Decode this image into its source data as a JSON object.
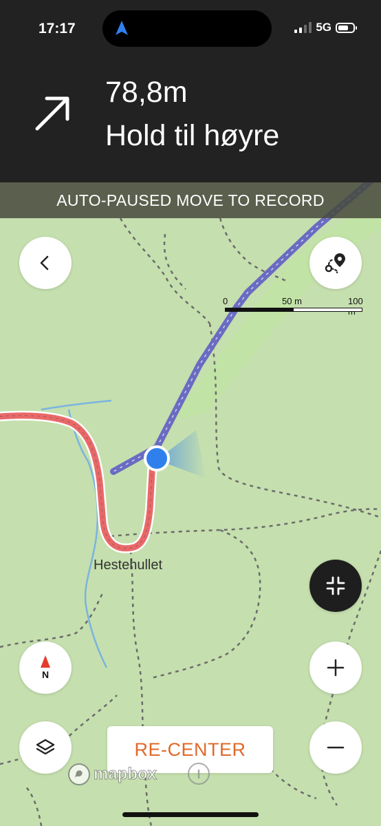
{
  "status_bar": {
    "time": "17:17",
    "network": "5G",
    "signal_bars": 2,
    "signal_bars_total": 4,
    "location_icon": "navigation-arrow-icon"
  },
  "navigation": {
    "distance": "78,8m",
    "instruction": "Hold til høyre",
    "turn_icon": "arrow-up-right-icon"
  },
  "banner": {
    "text": "AUTO-PAUSED MOVE TO RECORD"
  },
  "scale": {
    "labels": [
      "0",
      "50 m",
      "100 m"
    ]
  },
  "map": {
    "place_label": "Hestehullet",
    "attribution": "mapbox"
  },
  "buttons": {
    "back": "chevron-left-icon",
    "route": "route-pin-icon",
    "collapse": "collapse-arrows-icon",
    "compass": "compass-icon",
    "compass_label": "N",
    "zoom_in": "plus-icon",
    "zoom_out": "minus-icon",
    "layers": "layers-icon",
    "recenter_label": "RE-CENTER"
  },
  "colors": {
    "route_planned": "#6a6bc2",
    "route_recorded": "#ea6868",
    "location_dot": "#2f80ed",
    "recenter_text": "#e0682a",
    "map_background": "#c5dfae"
  }
}
